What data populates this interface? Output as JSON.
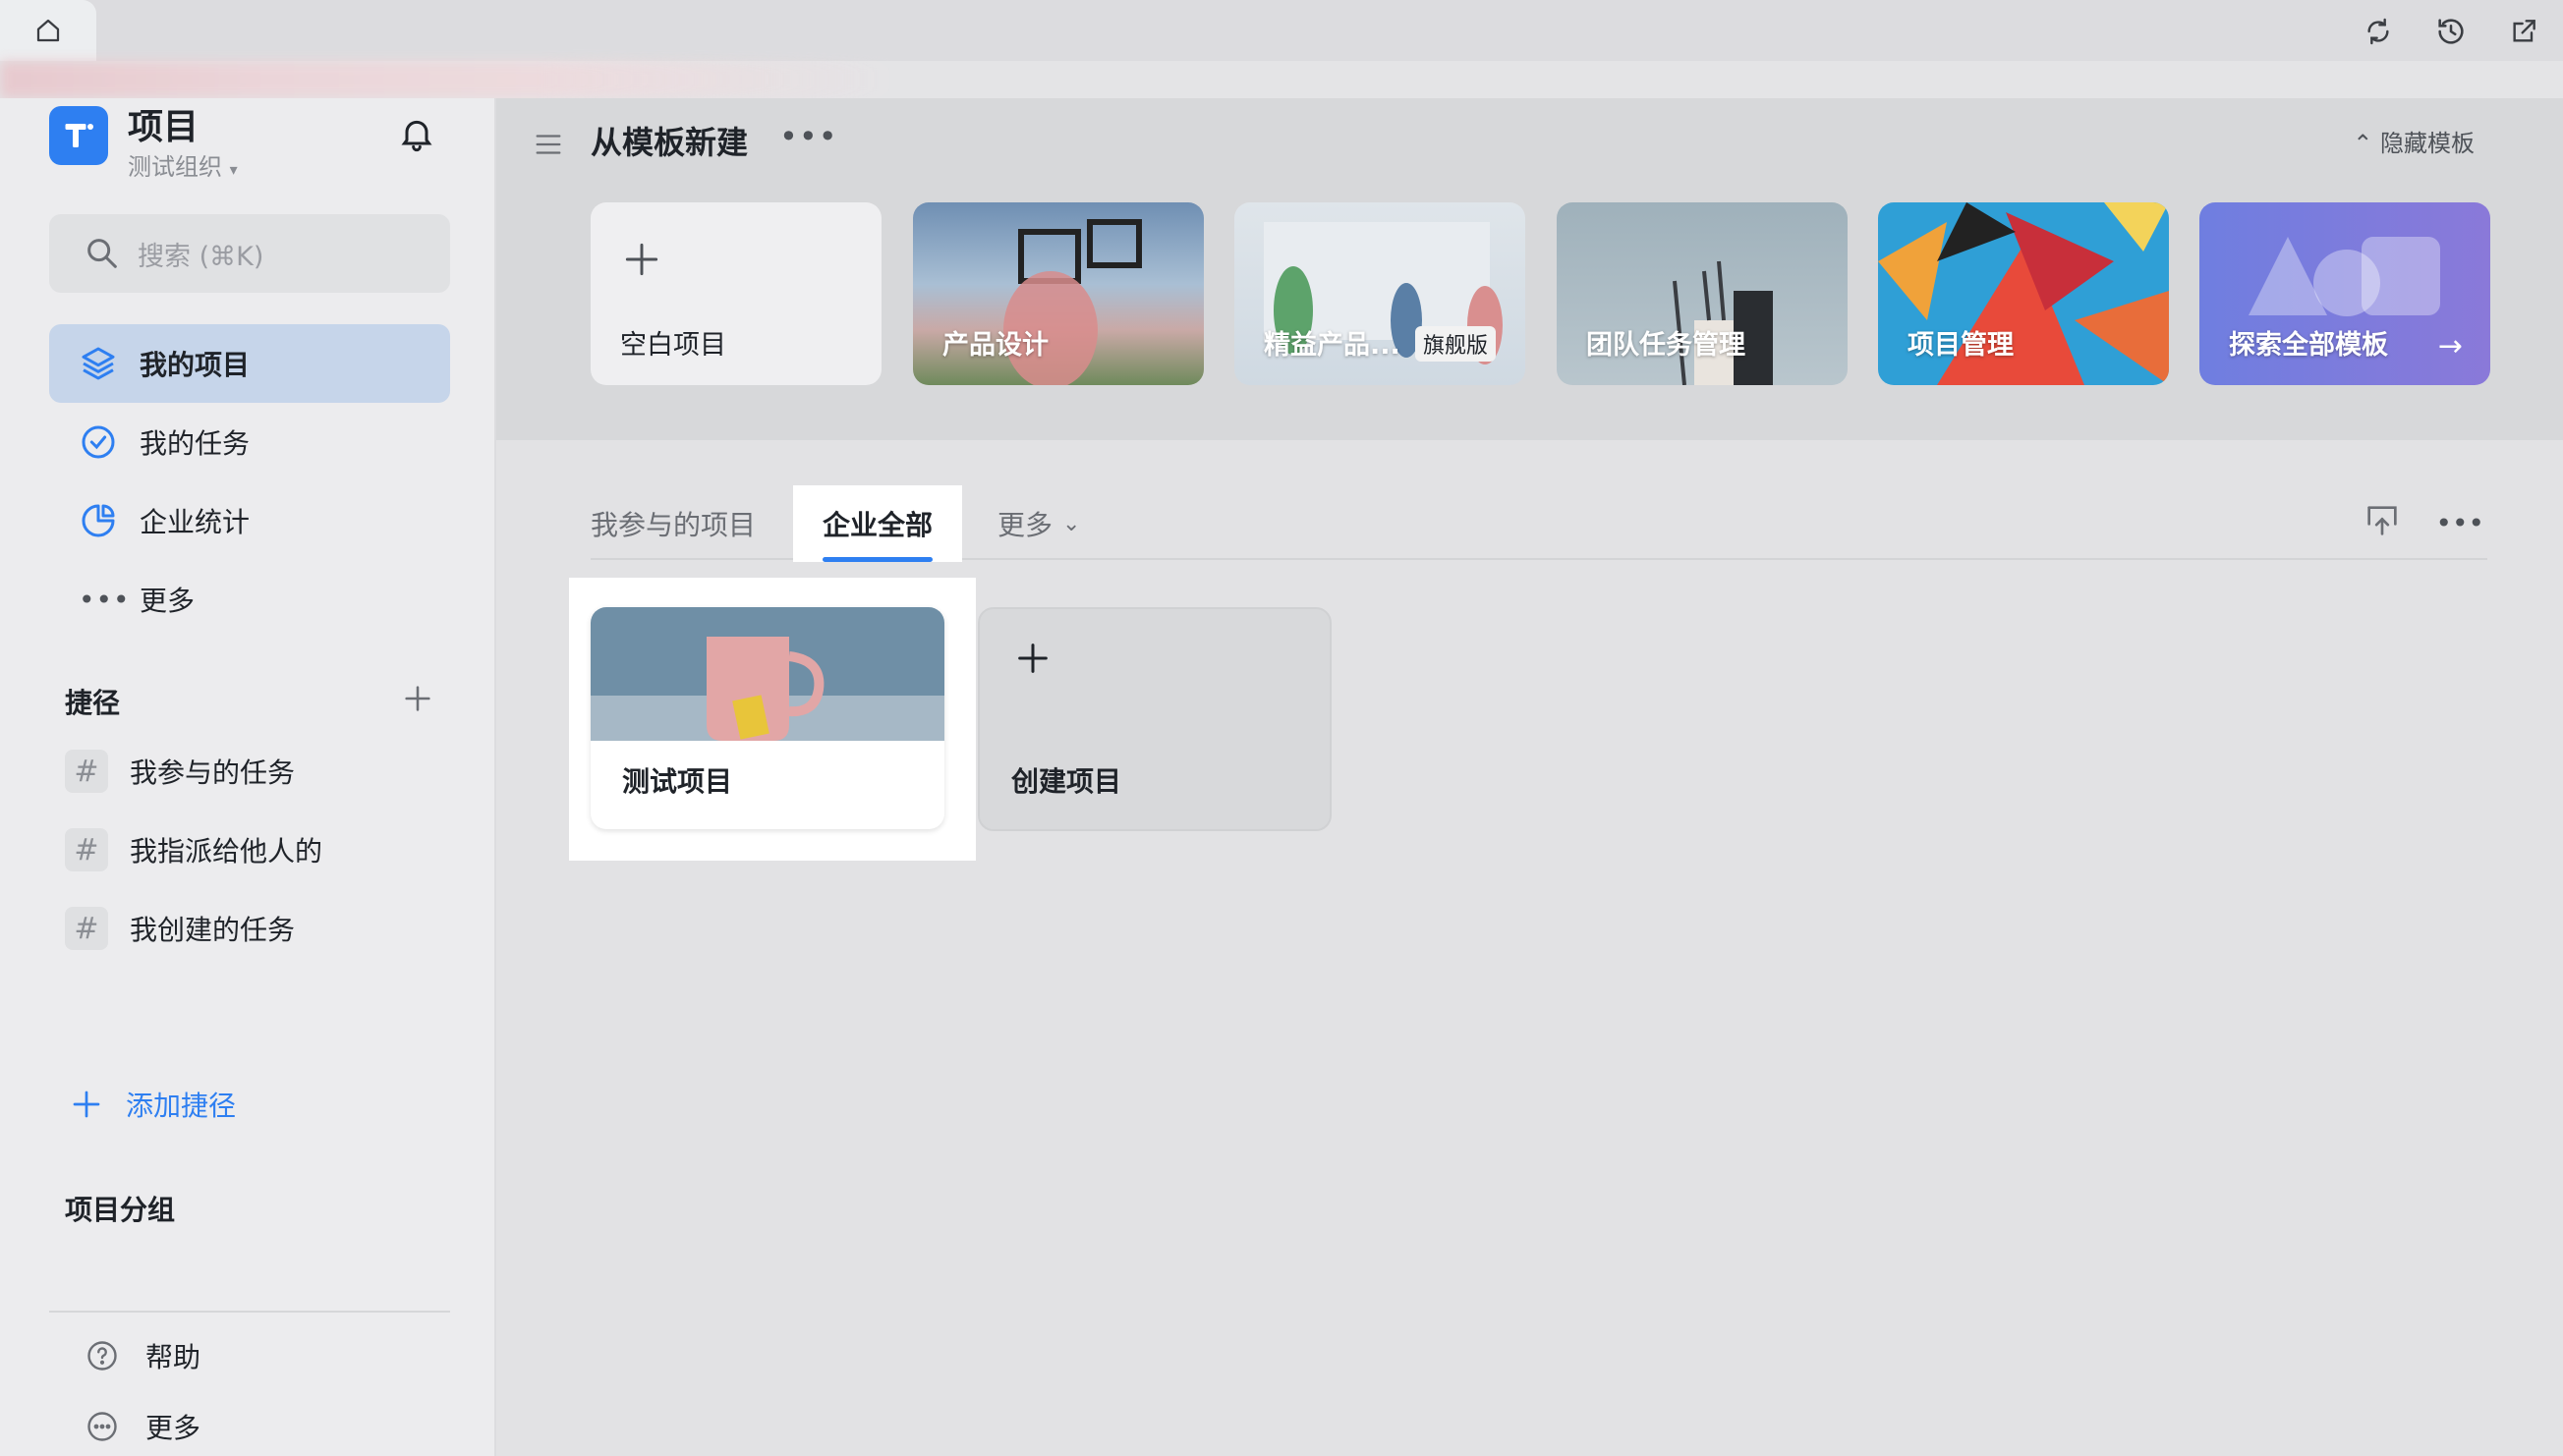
{
  "sidebar": {
    "app_title": "项目",
    "org_name": "测试组织",
    "search_placeholder": "搜索 (⌘K)",
    "nav": [
      {
        "label": "我的项目",
        "icon": "layers-icon",
        "active": true
      },
      {
        "label": "我的任务",
        "icon": "check-circle-icon"
      },
      {
        "label": "企业统计",
        "icon": "pie-chart-icon"
      },
      {
        "label": "更多",
        "icon": "more-dots-icon"
      }
    ],
    "shortcuts_title": "捷径",
    "shortcuts": [
      {
        "label": "我参与的任务"
      },
      {
        "label": "我指派给他人的"
      },
      {
        "label": "我创建的任务"
      }
    ],
    "add_shortcut": "添加捷径",
    "groups_title": "项目分组",
    "footer": [
      {
        "label": "帮助",
        "icon": "help-icon"
      },
      {
        "label": "更多",
        "icon": "more-circle-icon"
      }
    ]
  },
  "templates": {
    "title": "从模板新建",
    "hide_label": "隐藏模板",
    "items": [
      {
        "label": "空白项目"
      },
      {
        "label": "产品设计"
      },
      {
        "label": "精益产品...",
        "badge": "旗舰版"
      },
      {
        "label": "团队任务管理"
      },
      {
        "label": "项目管理"
      },
      {
        "label": "探索全部模板"
      }
    ]
  },
  "tabs": [
    {
      "label": "我参与的项目"
    },
    {
      "label": "企业全部",
      "active": true
    },
    {
      "label": "更多"
    }
  ],
  "projects": [
    {
      "label": "测试项目"
    }
  ],
  "create_project": "创建项目",
  "colors": {
    "accent": "#2e7ff1",
    "sidebar_bg": "#ececee",
    "main_bg": "#e2e2e4"
  }
}
